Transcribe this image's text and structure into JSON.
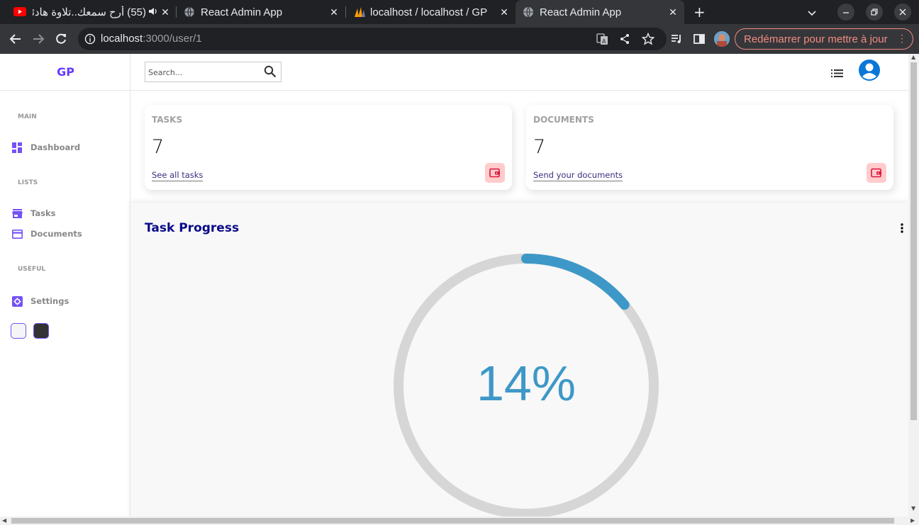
{
  "browser": {
    "tabs": [
      {
        "title": "(55) أرح سمعك..تلاوة هادئة",
        "favicon": "youtube-icon"
      },
      {
        "title": "React Admin App",
        "favicon": "globe-icon"
      },
      {
        "title": "localhost / localhost / GP",
        "favicon": "phpmyadmin-icon"
      },
      {
        "title": "React Admin App",
        "favicon": "globe-icon",
        "active": true
      }
    ],
    "url_host": "localhost",
    "url_rest": ":3000/user/1",
    "restart_label": "Redémarrer pour mettre à jour"
  },
  "sidebar": {
    "logo": "GP",
    "sections": {
      "main": "MAIN",
      "lists": "LISTS",
      "useful": "USEFUL"
    },
    "items": {
      "dashboard": "Dashboard",
      "tasks": "Tasks",
      "documents": "Documents",
      "settings": "Settings"
    },
    "accent_color": "#7451f8"
  },
  "topbar": {
    "search_placeholder": "Search..."
  },
  "widgets": [
    {
      "title": "TASKS",
      "counter": "7",
      "link": "See all tasks"
    },
    {
      "title": "DOCUMENTS",
      "counter": "7",
      "link": "Send your documents"
    }
  ],
  "progress": {
    "title": "Task Progress",
    "percent_label": "14%",
    "value": 0.14,
    "color": "#3e98c7",
    "track_color": "#d6d6d6"
  }
}
